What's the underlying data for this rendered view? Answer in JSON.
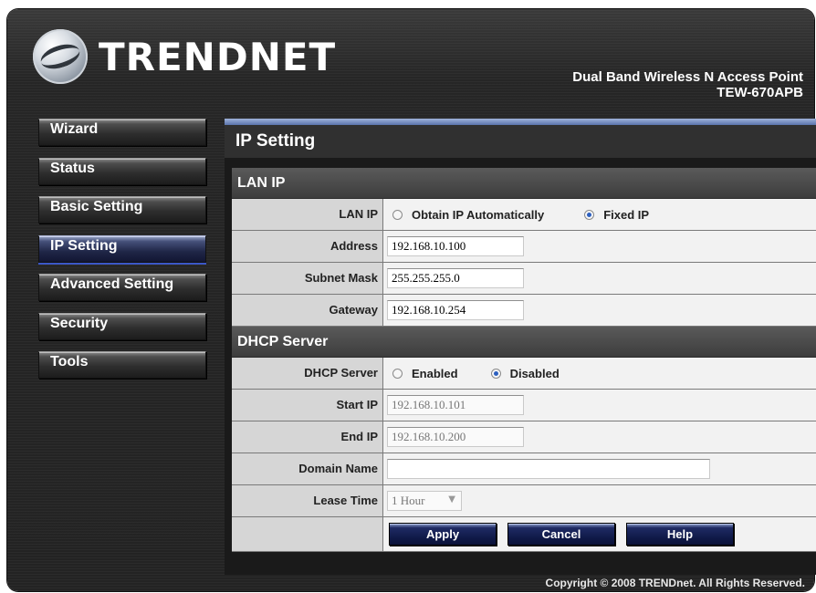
{
  "header": {
    "brand": "TRENDNET",
    "product_line": "Dual Band Wireless N Access Point",
    "model": "TEW-670APB"
  },
  "sidebar": {
    "items": [
      {
        "label": "Wizard"
      },
      {
        "label": "Status"
      },
      {
        "label": "Basic Setting"
      },
      {
        "label": "IP Setting",
        "active": true
      },
      {
        "label": "Advanced Setting"
      },
      {
        "label": "Security"
      },
      {
        "label": "Tools"
      }
    ]
  },
  "page": {
    "title": "IP Setting",
    "lan_section": "LAN IP",
    "lan": {
      "mode_label": "LAN IP",
      "option_auto": "Obtain IP Automatically",
      "option_fixed": "Fixed IP",
      "selected": "Fixed IP",
      "address_label": "Address",
      "address": "192.168.10.100",
      "subnet_label": "Subnet Mask",
      "subnet": "255.255.255.0",
      "gateway_label": "Gateway",
      "gateway": "192.168.10.254"
    },
    "dhcp_section": "DHCP Server",
    "dhcp": {
      "server_label": "DHCP Server",
      "option_enabled": "Enabled",
      "option_disabled": "Disabled",
      "selected": "Disabled",
      "start_label": "Start IP",
      "start_ip": "192.168.10.101",
      "end_label": "End IP",
      "end_ip": "192.168.10.200",
      "domain_label": "Domain Name",
      "domain": "",
      "lease_label": "Lease Time",
      "lease": "1 Hour"
    },
    "buttons": {
      "apply": "Apply",
      "cancel": "Cancel",
      "help": "Help"
    }
  },
  "footer": {
    "copyright": "Copyright © 2008 TRENDnet. All Rights Reserved."
  },
  "colors": {
    "accent": "#2c5fbf",
    "panel_bar": "#5a74ad",
    "button": "#0f1947"
  },
  "icons": {
    "logo": "trendnet-logo-icon",
    "dropdown": "chevron-down-icon",
    "radio": "radio-icon"
  }
}
